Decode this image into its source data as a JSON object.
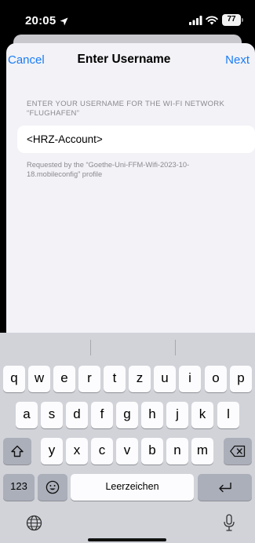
{
  "status_bar": {
    "time": "20:05",
    "battery": "77",
    "icons": [
      "location-arrow-icon",
      "signal-bars-icon",
      "wifi-icon",
      "battery-icon"
    ]
  },
  "nav": {
    "cancel_label": "Cancel",
    "title": "Enter Username",
    "next_label": "Next"
  },
  "form": {
    "section_header": "ENTER YOUR USERNAME FOR THE WI-FI NETWORK “FLUGHAFEN”",
    "username_value": "<HRZ-Account>",
    "footnote": "Requested by the “Goethe-Uni-FFM-Wifi-2023-10-18.mobileconfig” profile"
  },
  "keyboard": {
    "row1": [
      "q",
      "w",
      "e",
      "r",
      "t",
      "z",
      "u",
      "i",
      "o",
      "p"
    ],
    "row2": [
      "a",
      "s",
      "d",
      "f",
      "g",
      "h",
      "j",
      "k",
      "l"
    ],
    "row3": [
      "y",
      "x",
      "c",
      "v",
      "b",
      "n",
      "m"
    ],
    "numbers_label": "123",
    "space_label": "Leerzeichen",
    "icons": [
      "shift-icon",
      "delete-icon",
      "emoji-icon",
      "return-icon",
      "globe-icon",
      "microphone-icon"
    ]
  },
  "colors": {
    "accent": "#1a7cf5",
    "sheet_background": "#f2f2f7",
    "keyboard_background": "#d1d3d9"
  }
}
